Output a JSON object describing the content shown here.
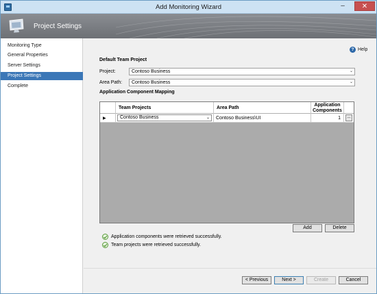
{
  "window": {
    "title": "Add Monitoring Wizard",
    "minimize_glyph": "–",
    "close_glyph": "✕"
  },
  "banner": {
    "title": "Project Settings"
  },
  "nav": {
    "items": [
      {
        "label": "Monitoring Type",
        "active": false
      },
      {
        "label": "General Properties",
        "active": false
      },
      {
        "label": "Server Settings",
        "active": false
      },
      {
        "label": "Project Settings",
        "active": true
      },
      {
        "label": "Complete",
        "active": false
      }
    ]
  },
  "help": {
    "label": "Help",
    "glyph": "?"
  },
  "default_project": {
    "section_title": "Default Team Project",
    "project_label": "Project:",
    "project_value": "Contoso Business",
    "area_path_label": "Area Path:",
    "area_path_value": "Contoso Business"
  },
  "mapping": {
    "section_title": "Application Component Mapping",
    "columns": {
      "team_projects": "Team Projects",
      "area_path": "Area Path",
      "app_components_line1": "Application",
      "app_components_line2": "Components"
    },
    "rows": [
      {
        "team_project": "Contoso Business",
        "area_path": "Contoso Business\\UI",
        "components": "1",
        "ellipsis": "..."
      }
    ],
    "row_marker": "▶",
    "add_label": "Add",
    "delete_label": "Delete"
  },
  "status": {
    "messages": [
      "Application components were retrieved successfully.",
      "Team projects were retrieved successfully."
    ]
  },
  "footer": {
    "previous_label": "< Previous",
    "next_label": "Next >",
    "create_label": "Create",
    "cancel_label": "Cancel"
  },
  "icons": {
    "app": "app-icon",
    "banner": "monitor-icon",
    "help": "help-icon",
    "success": "check-circle-icon",
    "dropdown": "chevron-down-icon"
  },
  "colors": {
    "titlebar": "#cde2f3",
    "banner": "#7a7d82",
    "nav_active": "#3b77b7",
    "grid_empty": "#ababab",
    "success_green": "#3f8a1f",
    "help_blue": "#2d68a8"
  }
}
